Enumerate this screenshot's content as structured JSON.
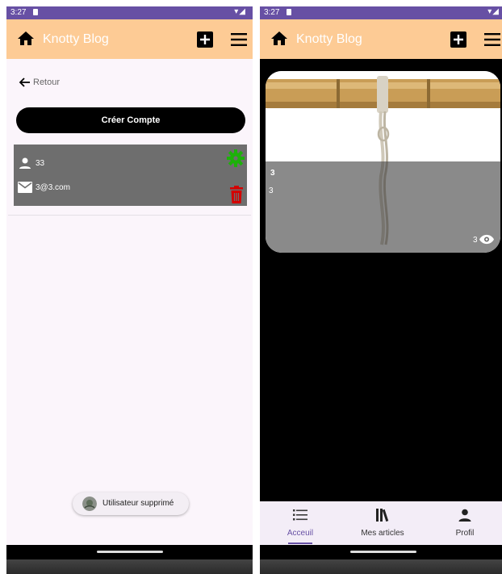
{
  "status_bar": {
    "time": "3:27",
    "icons": "▾◢"
  },
  "app_bar": {
    "title": "Knotty Blog",
    "icons": [
      "home-icon",
      "add-box-icon",
      "menu-icon"
    ]
  },
  "users_screen": {
    "back_label": "Retour",
    "create_button": "Créer Compte",
    "user": {
      "name": "33",
      "email": "3@3.com"
    },
    "snackbar": "Utilisateur supprimé"
  },
  "articles_screen": {
    "article": {
      "title": "3",
      "description": "3",
      "views": "3"
    },
    "nav": [
      {
        "label": "Acceuil",
        "icon": "list-icon",
        "selected": true
      },
      {
        "label": "Mes articles",
        "icon": "library-icon",
        "selected": false
      },
      {
        "label": "Profil",
        "icon": "person-icon",
        "selected": false
      }
    ]
  },
  "colors": {
    "status_bar": "#6750a4",
    "app_bar": "#fdcb95",
    "settings": "#1db10a",
    "delete": "#d40000",
    "card": "#6e6e6e"
  }
}
